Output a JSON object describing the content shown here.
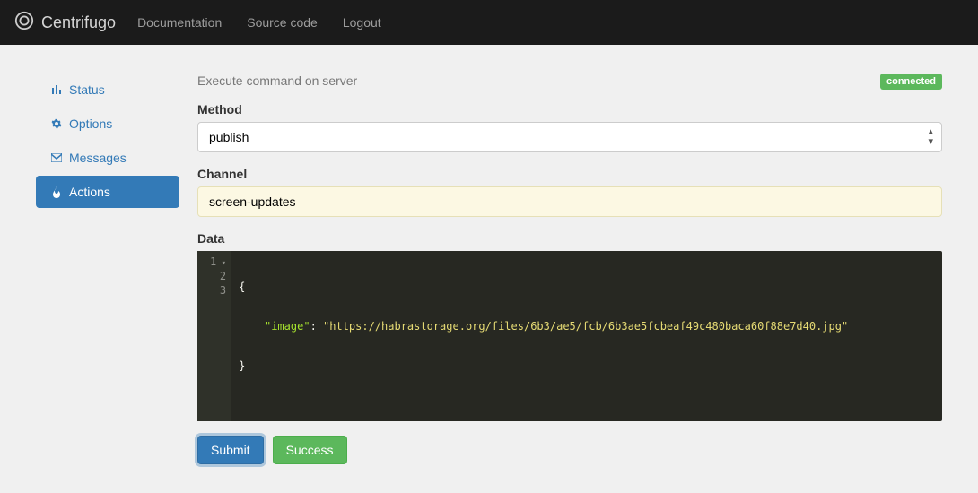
{
  "navbar": {
    "brand": "Centrifugo",
    "links": [
      {
        "label": "Documentation"
      },
      {
        "label": "Source code"
      },
      {
        "label": "Logout"
      }
    ]
  },
  "sidebar": {
    "items": [
      {
        "label": "Status"
      },
      {
        "label": "Options"
      },
      {
        "label": "Messages"
      },
      {
        "label": "Actions"
      }
    ]
  },
  "page": {
    "subtitle": "Execute command on server",
    "status_badge": "connected"
  },
  "form": {
    "method_label": "Method",
    "method_value": "publish",
    "channel_label": "Channel",
    "channel_value": "screen-updates",
    "data_label": "Data",
    "data_json": {
      "key": "\"image\"",
      "value": "\"https://habrastorage.org/files/6b3/ae5/fcb/6b3ae5fcbeaf49c480baca60f88e7d40.jpg\""
    },
    "gutter": [
      "1",
      "2",
      "3"
    ]
  },
  "buttons": {
    "submit": "Submit",
    "success": "Success"
  }
}
